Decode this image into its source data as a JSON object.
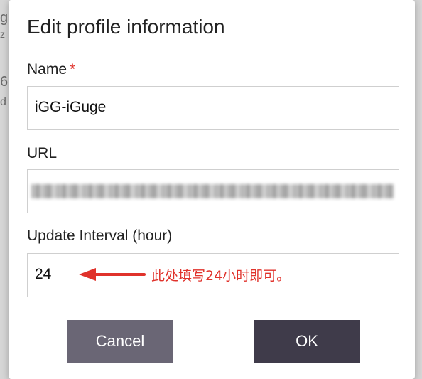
{
  "background": {
    "fragments": [
      "g",
      "z",
      "6",
      "d"
    ]
  },
  "dialog": {
    "title": "Edit profile information",
    "fields": {
      "name": {
        "label": "Name",
        "required_mark": "*",
        "value": "iGG-iGuge"
      },
      "url": {
        "label": "URL",
        "value_redacted": true
      },
      "interval": {
        "label": "Update Interval (hour)",
        "value": "24",
        "annotation": "此处填写24小时即可。"
      }
    },
    "buttons": {
      "cancel": "Cancel",
      "ok": "OK"
    }
  },
  "colors": {
    "accent_red": "#e0322b",
    "cancel_button": "#6a6675",
    "ok_button": "#3f3b4a"
  },
  "icons": {
    "annotation_arrow": "left-arrow-icon"
  }
}
